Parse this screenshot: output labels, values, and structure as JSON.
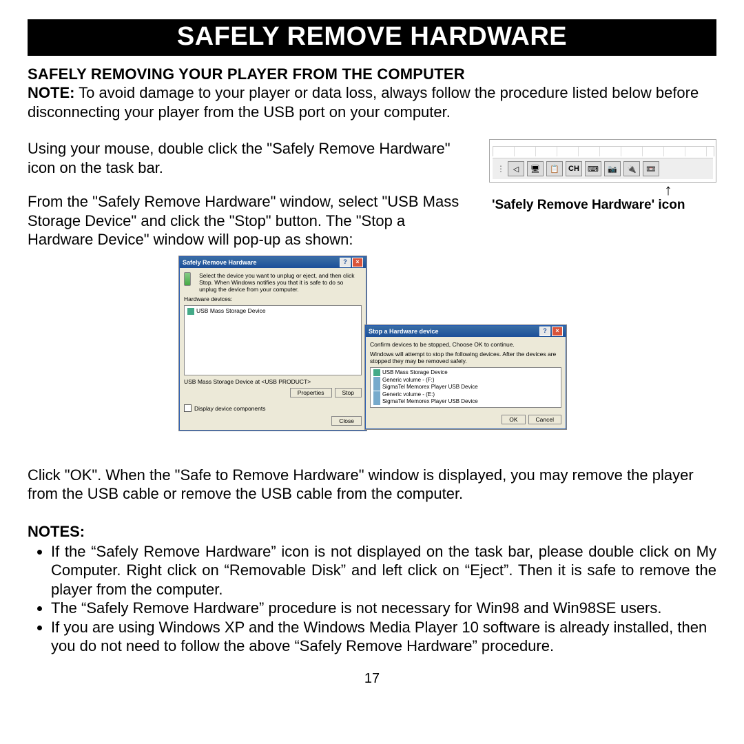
{
  "banner_title": "SAFELY REMOVE HARDWARE",
  "sub_heading": "SAFELY REMOVING YOUR PLAYER FROM THE COMPUTER",
  "note_label": "NOTE:",
  "note_text": " To avoid damage to your player or data loss, always follow the procedure listed below before disconnecting your player from the USB port on your computer.",
  "para1": "Using your mouse, double click the \"Safely Remove Hardware\" icon on the task bar.",
  "para2": "From the \"Safely Remove Hardware\" window, select \"USB Mass Storage Device\" and click the \"Stop\" button. The \"Stop a Hardware Device\" window will pop-up as shown:",
  "tray_caption": "'Safely Remove Hardware' icon",
  "tray_icons": [
    "◁",
    "🖥",
    "📋",
    "CH",
    "⌨",
    "📷",
    "🔌",
    "📼"
  ],
  "arrow_up": "↑",
  "win1": {
    "title": "Safely Remove Hardware",
    "instr": "Select the device you want to unplug or eject, and then click Stop. When Windows notifies you that it is safe to do so unplug the device from your computer.",
    "list_label": "Hardware devices:",
    "device": "USB Mass Storage Device",
    "footer_label": "USB Mass Storage Device at <USB PRODUCT>",
    "btn_props": "Properties",
    "btn_stop": "Stop",
    "check_label": "Display device components",
    "btn_close": "Close"
  },
  "win2": {
    "title": "Stop a Hardware device",
    "instr1": "Confirm devices to be stopped, Choose OK to continue.",
    "instr2": "Windows will attempt to stop the following devices. After the devices are stopped they may be removed safely.",
    "items": [
      "USB Mass Storage Device",
      "Generic volume - (F:)",
      "SigmaTel Memorex Player USB Device",
      "Generic volume - (E:)",
      "SigmaTel Memorex Player USB Device"
    ],
    "btn_ok": "OK",
    "btn_cancel": "Cancel"
  },
  "para3": "Click \"OK\". When the \"Safe to Remove Hardware\" window is displayed, you may remove the player from the USB cable or remove the USB cable from the computer.",
  "notes_header": "NOTES:",
  "notes": [
    "If the “Safely Remove Hardware” icon is not displayed on the task bar, please double click on My Computer.  Right click on “Removable Disk” and left click on “Eject”.  Then it is safe to remove the player from the computer.",
    "The “Safely Remove Hardware” procedure is not necessary for Win98 and Win98SE users.",
    "If you are using Windows XP and the Windows Media Player 10 software is already installed, then you do not need to follow the above “Safely Remove Hardware” procedure."
  ],
  "page_number": "17"
}
